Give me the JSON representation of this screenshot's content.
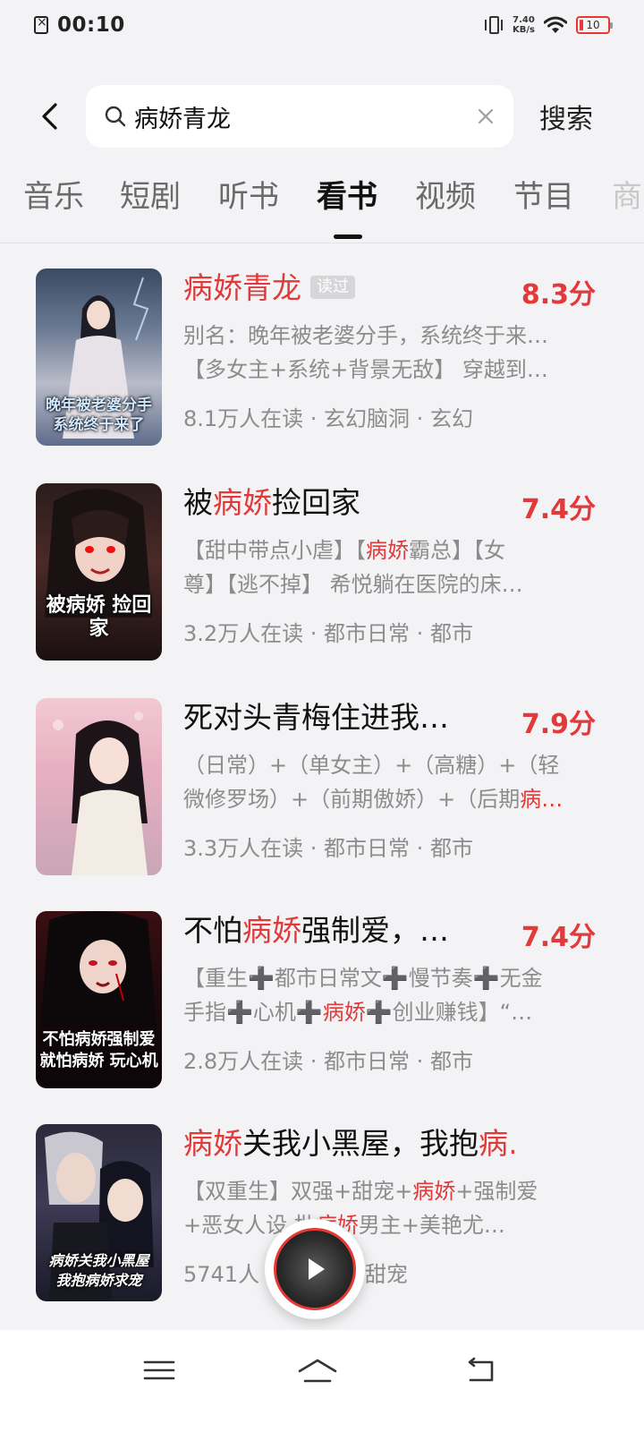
{
  "status_bar": {
    "time": "00:10",
    "net_speed_value": "7.40",
    "net_speed_unit": "KB/s",
    "battery": "10"
  },
  "search": {
    "query": "病娇青龙",
    "action_label": "搜索"
  },
  "tabs": [
    {
      "label": "音乐",
      "active": false
    },
    {
      "label": "短剧",
      "active": false
    },
    {
      "label": "听书",
      "active": false
    },
    {
      "label": "看书",
      "active": true
    },
    {
      "label": "视频",
      "active": false
    },
    {
      "label": "节目",
      "active": false
    },
    {
      "label": "商",
      "active": false
    }
  ],
  "books": [
    {
      "title_parts": [
        {
          "text": "病娇青龙",
          "hl": true
        }
      ],
      "badge": "读过",
      "score": "8.3分",
      "desc_line1": [
        {
          "text": "别名：晚年被老婆分手，系统终于来…",
          "hl": false
        }
      ],
      "desc_line2": [
        {
          "text": "【多女主+系统+背景无敌】 穿越到…",
          "hl": false
        }
      ],
      "meta": "8.1万人在读 · 玄幻脑洞 · 玄幻",
      "cover_text": "晚年被老婆分手 系统终于来了"
    },
    {
      "title_parts": [
        {
          "text": "被",
          "hl": false
        },
        {
          "text": "病娇",
          "hl": true
        },
        {
          "text": "捡回家",
          "hl": false
        }
      ],
      "badge": "",
      "score": "7.4分",
      "desc_line1": [
        {
          "text": "【甜中带点小虐】【",
          "hl": false
        },
        {
          "text": "病娇",
          "hl": true
        },
        {
          "text": "霸总】【女",
          "hl": false
        }
      ],
      "desc_line2": [
        {
          "text": "尊】【逃不掉】 希悦躺在医院的床…",
          "hl": false
        }
      ],
      "meta": "3.2万人在读 · 都市日常 · 都市",
      "cover_text": "被病娇 捡回家"
    },
    {
      "title_parts": [
        {
          "text": "死对头青梅住进我…",
          "hl": false
        }
      ],
      "badge": "",
      "score": "7.9分",
      "desc_line1": [
        {
          "text": "（日常）+（单女主）+（高糖）+（轻",
          "hl": false
        }
      ],
      "desc_line2": [
        {
          "text": "微修罗场）+（前期傲娇）+（后期",
          "hl": false
        },
        {
          "text": "病…",
          "hl": true
        }
      ],
      "meta": "3.3万人在读 · 都市日常 · 都市",
      "cover_text": ""
    },
    {
      "title_parts": [
        {
          "text": "不怕",
          "hl": false
        },
        {
          "text": "病娇",
          "hl": true
        },
        {
          "text": "强制爱，…",
          "hl": false
        }
      ],
      "badge": "",
      "score": "7.4分",
      "desc_line1": [
        {
          "text": "【重生➕都市日常文➕慢节奏➕无金",
          "hl": false
        }
      ],
      "desc_line2": [
        {
          "text": "手指➕心机➕",
          "hl": false
        },
        {
          "text": "病娇",
          "hl": true
        },
        {
          "text": "➕创业赚钱】“…",
          "hl": false
        }
      ],
      "meta": "2.8万人在读 · 都市日常 · 都市",
      "cover_text": "不怕病娇强制爱 就怕病娇 玩心机"
    },
    {
      "title_parts": [
        {
          "text": "病娇",
          "hl": true
        },
        {
          "text": "关我小黑屋，我抱",
          "hl": false
        },
        {
          "text": "病…",
          "hl": true
        }
      ],
      "badge": "",
      "score": "",
      "desc_line1": [
        {
          "text": "【双重生】双强+甜宠+",
          "hl": false
        },
        {
          "text": "病娇",
          "hl": true
        },
        {
          "text": "+强制爱",
          "hl": false
        }
      ],
      "desc_line2": [
        {
          "text": "+恶女人设 批",
          "hl": false
        },
        {
          "text": "病娇",
          "hl": true
        },
        {
          "text": "男主+美艳尤…",
          "hl": false
        }
      ],
      "meta": "5741人 · 代言情 · 甜宠",
      "cover_text": "病娇关我小黑屋 我抱病娇求宠"
    }
  ],
  "colors": {
    "highlight": "#e03a3a",
    "muted_text": "#8c8c8c",
    "background": "#f3f3f5"
  }
}
